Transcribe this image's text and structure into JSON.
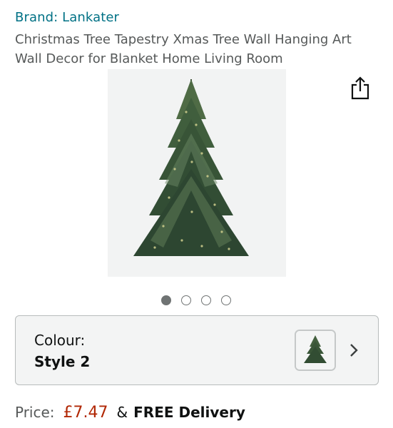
{
  "product": {
    "brand": "Brand: Lankater",
    "title": "Christmas Tree Tapestry Xmas Tree Wall Hanging Art Wall Decor for Blanket Home Living Room"
  },
  "gallery": {
    "image_count": 4,
    "active_index": 0,
    "share_icon": "share-icon"
  },
  "variant": {
    "label": "Colour:",
    "value": "Style 2",
    "chevron_icon": "chevron-right-icon"
  },
  "price": {
    "label": "Price:",
    "value": "£7.47",
    "ampersand": "&",
    "delivery": "FREE Delivery"
  },
  "colors": {
    "brand_link": "#007185",
    "price": "#b12704"
  }
}
